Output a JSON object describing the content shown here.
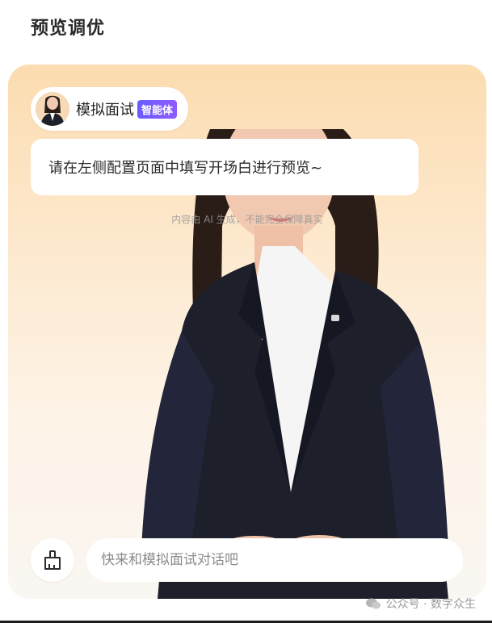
{
  "page": {
    "title": "预览调优"
  },
  "agent": {
    "name": "模拟面试",
    "badge": "智能体"
  },
  "message": {
    "text": "请在左侧配置页面中填写开场白进行预览~"
  },
  "disclaimer": "内容由 AI 生成，不能完全保障真实",
  "composer": {
    "placeholder": "快来和模拟面试对话吧",
    "clear_icon": "broom-icon"
  },
  "watermark": {
    "text": "公众号 · 数字众生",
    "icon": "wechat-icon"
  },
  "colors": {
    "card_gradient_top": "#fcdcb0",
    "badge": "#6a5cff",
    "suit": "#1d1f2b",
    "shirt": "#f5f5f5"
  }
}
